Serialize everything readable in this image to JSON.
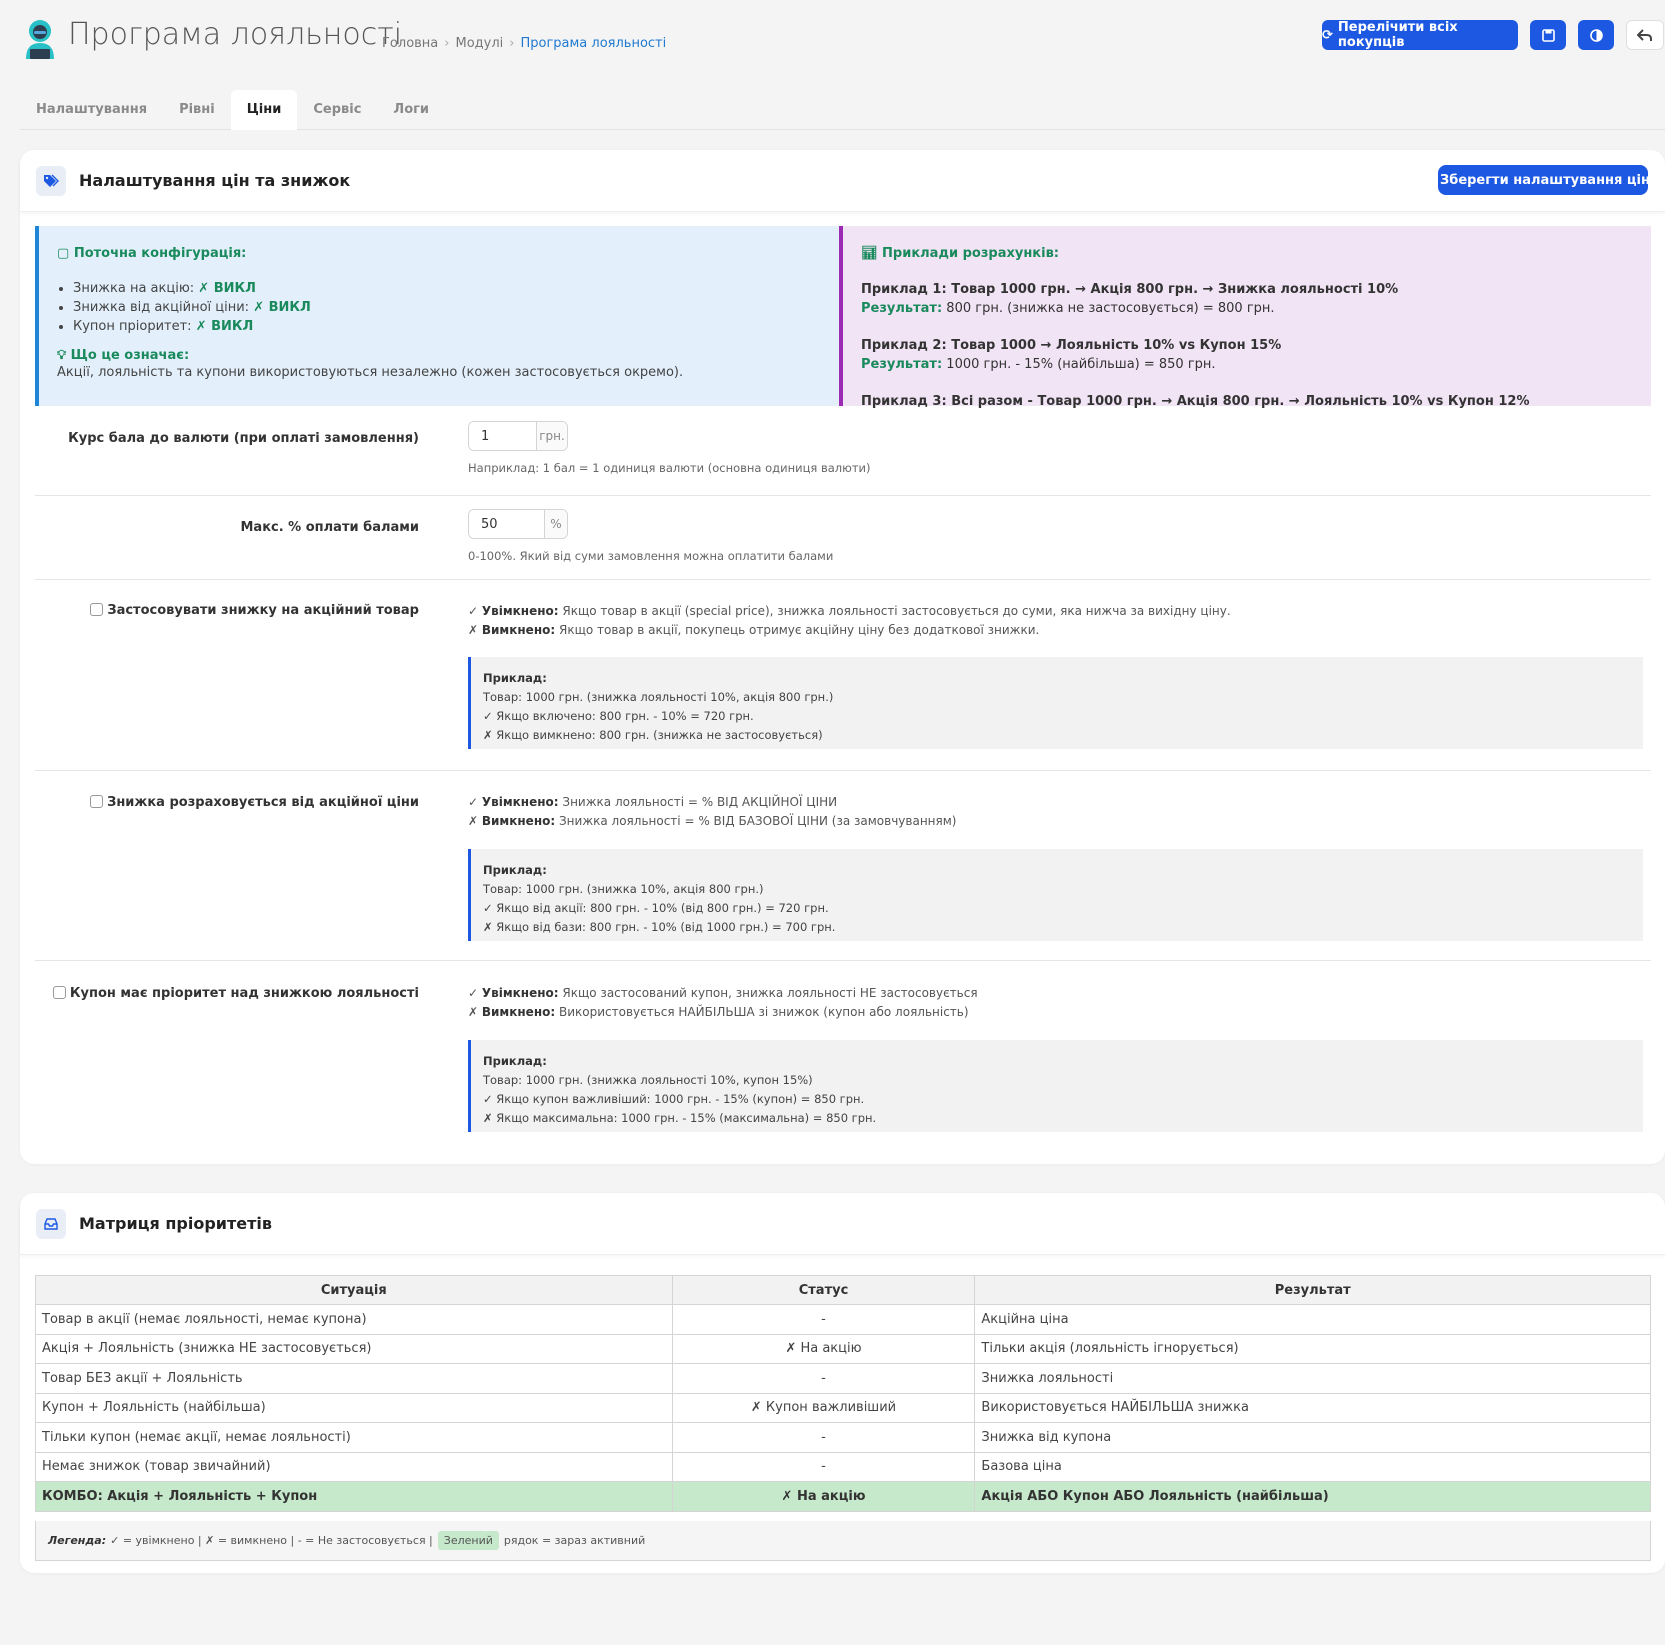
{
  "header": {
    "title": "Програма лояльності",
    "breadcrumb": [
      "Головна",
      "Модулі",
      "Програма лояльності"
    ],
    "recalc_label": "Перелічити всіх покупців"
  },
  "tabs": [
    "Налаштування",
    "Рівні",
    "Ціни",
    "Сервіс",
    "Логи"
  ],
  "active_tab": "Ціни",
  "prices_card": {
    "title": "Налаштування цін та знижок",
    "save_label": "Зберегти налаштування цін",
    "config": {
      "title": "Поточна конфігурація:",
      "items": [
        {
          "label": "Знижка на акцію:",
          "value": "ВИКЛ"
        },
        {
          "label": "Знижка від акційної ціни:",
          "value": "ВИКЛ"
        },
        {
          "label": "Купон пріоритет:",
          "value": "ВИКЛ"
        }
      ],
      "meaning_title": "Що це означає:",
      "meaning_text": "Акції, лояльність та купони використовуються незалежно (кожен застосовується окремо)."
    },
    "examples": {
      "title": "Приклади розрахунків:",
      "result_label": "Результат:",
      "ex1_title": "Приклад 1: Товар 1000 грн. → Акція 800 грн. → Знижка лояльності 10%",
      "ex1_result": "800 грн. (знижка не застосовується) = 800 грн.",
      "ex2_title": "Приклад 2: Товар 1000 → Лояльність 10% vs Купон 15%",
      "ex2_result": "1000 грн. - 15% (найбільша) = 850 грн.",
      "ex3_title": "Приклад 3: Всі разом - Товар 1000 грн. → Акція 800 грн. → Лояльність 10% vs Купон 12%"
    },
    "rate": {
      "label": "Курс бала до валюти (при оплаті замовлення)",
      "value": "1",
      "unit": "грн.",
      "help": "Наприклад: 1 бал = 1 одиниця валюти (основна одиниця валюти)"
    },
    "max_pct": {
      "label": "Макс. % оплати балами",
      "value": "50",
      "unit": "%",
      "help": "0-100%. Який від суми замовлення можна оплатити балами"
    },
    "on_label": "Увімкнено:",
    "off_label": "Вимкнено:",
    "example_label": "Приклад:",
    "opt_special": {
      "label": "Застосовувати знижку на акційний товар",
      "on": "Якщо товар в акції (special price), знижка лояльності застосовується до суми, яка нижча за вихідну ціну.",
      "off": "Якщо товар в акції, покупець отримує акційну ціну без додаткової знижки.",
      "ex": [
        "Товар: 1000 грн. (знижка лояльності 10%, акція 800 грн.)",
        "✓ Якщо включено: 800 грн. - 10% = 720 грн.",
        "✗ Якщо вимкнено: 800 грн. (знижка не застосовується)"
      ]
    },
    "opt_from_special": {
      "label": "Знижка розраховується від акційної ціни",
      "on": "Знижка лояльності = % ВІД АКЦІЙНОЇ ЦІНИ",
      "off": "Знижка лояльності = % ВІД БАЗОВОЇ ЦІНИ (за замовчуванням)",
      "ex": [
        "Товар: 1000 грн. (знижка 10%, акція 800 грн.)",
        "✓ Якщо від акції: 800 грн. - 10% (від 800 грн.) = 720 грн.",
        "✗ Якщо від бази: 800 грн. - 10% (від 1000 грн.) = 700 грн."
      ]
    },
    "opt_coupon": {
      "label": "Купон має пріоритет над знижкою лояльності",
      "on": "Якщо застосований купон, знижка лояльності НЕ застосовується",
      "off": "Використовується НАЙБІЛЬША зі знижок (купон або лояльність)",
      "ex": [
        "Товар: 1000 грн. (знижка лояльності 10%, купон 15%)",
        "✓ Якщо купон важливіший: 1000 грн. - 15% (купон) = 850 грн.",
        "✗ Якщо максимальна: 1000 грн. - 15% (максимальна) = 850 грн."
      ]
    }
  },
  "matrix_card": {
    "title": "Матриця пріоритетів",
    "columns": [
      "Ситуація",
      "Статус",
      "Результат"
    ],
    "rows": [
      [
        "Товар в акції (немає лояльності, немає купона)",
        "-",
        "Акційна ціна"
      ],
      [
        "Акція + Лояльність (знижка НЕ застосовується)",
        "✗ На акцію",
        "Тільки акція (лояльність ігнорується)"
      ],
      [
        "Товар БЕЗ акції + Лояльність",
        "-",
        "Знижка лояльності"
      ],
      [
        "Купон + Лояльність (найбільша)",
        "✗ Купон важливіший",
        "Використовується НАЙБІЛЬША знижка"
      ],
      [
        "Тільки купон (немає акції, немає лояльності)",
        "-",
        "Знижка від купона"
      ],
      [
        "Немає знижок (товар звичайний)",
        "-",
        "Базова ціна"
      ],
      [
        "КОМБО: Акція + Лояльність + Купон",
        "✗ На акцію",
        "Акція АБО Купон АБО Лояльність (найбільша)"
      ]
    ],
    "legend": {
      "label": "Легенда:",
      "text1": "✓ = увімкнено | ✗ = вимкнено | - = Не застосовується |",
      "green": "Зелений",
      "text2": "рядок = зараз активний"
    }
  },
  "colors": {
    "primary": "#1d58e2",
    "success_text": "#1a8a5c",
    "active_row": "#c6e8cb"
  }
}
